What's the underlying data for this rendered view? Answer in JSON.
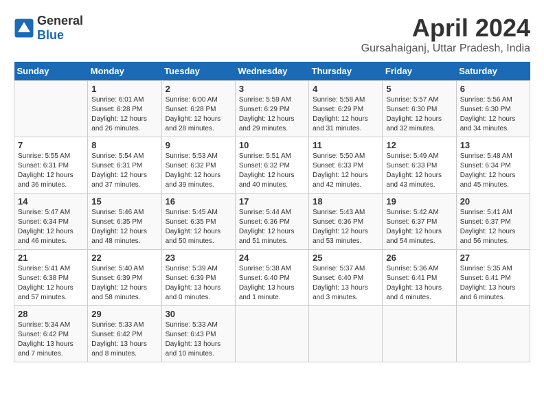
{
  "logo": {
    "text_general": "General",
    "text_blue": "Blue"
  },
  "header": {
    "month": "April 2024",
    "location": "Gursahaiganj, Uttar Pradesh, India"
  },
  "weekdays": [
    "Sunday",
    "Monday",
    "Tuesday",
    "Wednesday",
    "Thursday",
    "Friday",
    "Saturday"
  ],
  "rows": [
    [
      {
        "day": "",
        "sunrise": "",
        "sunset": "",
        "daylight": ""
      },
      {
        "day": "1",
        "sunrise": "Sunrise: 6:01 AM",
        "sunset": "Sunset: 6:28 PM",
        "daylight": "Daylight: 12 hours and 26 minutes."
      },
      {
        "day": "2",
        "sunrise": "Sunrise: 6:00 AM",
        "sunset": "Sunset: 6:28 PM",
        "daylight": "Daylight: 12 hours and 28 minutes."
      },
      {
        "day": "3",
        "sunrise": "Sunrise: 5:59 AM",
        "sunset": "Sunset: 6:29 PM",
        "daylight": "Daylight: 12 hours and 29 minutes."
      },
      {
        "day": "4",
        "sunrise": "Sunrise: 5:58 AM",
        "sunset": "Sunset: 6:29 PM",
        "daylight": "Daylight: 12 hours and 31 minutes."
      },
      {
        "day": "5",
        "sunrise": "Sunrise: 5:57 AM",
        "sunset": "Sunset: 6:30 PM",
        "daylight": "Daylight: 12 hours and 32 minutes."
      },
      {
        "day": "6",
        "sunrise": "Sunrise: 5:56 AM",
        "sunset": "Sunset: 6:30 PM",
        "daylight": "Daylight: 12 hours and 34 minutes."
      }
    ],
    [
      {
        "day": "7",
        "sunrise": "Sunrise: 5:55 AM",
        "sunset": "Sunset: 6:31 PM",
        "daylight": "Daylight: 12 hours and 36 minutes."
      },
      {
        "day": "8",
        "sunrise": "Sunrise: 5:54 AM",
        "sunset": "Sunset: 6:31 PM",
        "daylight": "Daylight: 12 hours and 37 minutes."
      },
      {
        "day": "9",
        "sunrise": "Sunrise: 5:53 AM",
        "sunset": "Sunset: 6:32 PM",
        "daylight": "Daylight: 12 hours and 39 minutes."
      },
      {
        "day": "10",
        "sunrise": "Sunrise: 5:51 AM",
        "sunset": "Sunset: 6:32 PM",
        "daylight": "Daylight: 12 hours and 40 minutes."
      },
      {
        "day": "11",
        "sunrise": "Sunrise: 5:50 AM",
        "sunset": "Sunset: 6:33 PM",
        "daylight": "Daylight: 12 hours and 42 minutes."
      },
      {
        "day": "12",
        "sunrise": "Sunrise: 5:49 AM",
        "sunset": "Sunset: 6:33 PM",
        "daylight": "Daylight: 12 hours and 43 minutes."
      },
      {
        "day": "13",
        "sunrise": "Sunrise: 5:48 AM",
        "sunset": "Sunset: 6:34 PM",
        "daylight": "Daylight: 12 hours and 45 minutes."
      }
    ],
    [
      {
        "day": "14",
        "sunrise": "Sunrise: 5:47 AM",
        "sunset": "Sunset: 6:34 PM",
        "daylight": "Daylight: 12 hours and 46 minutes."
      },
      {
        "day": "15",
        "sunrise": "Sunrise: 5:46 AM",
        "sunset": "Sunset: 6:35 PM",
        "daylight": "Daylight: 12 hours and 48 minutes."
      },
      {
        "day": "16",
        "sunrise": "Sunrise: 5:45 AM",
        "sunset": "Sunset: 6:35 PM",
        "daylight": "Daylight: 12 hours and 50 minutes."
      },
      {
        "day": "17",
        "sunrise": "Sunrise: 5:44 AM",
        "sunset": "Sunset: 6:36 PM",
        "daylight": "Daylight: 12 hours and 51 minutes."
      },
      {
        "day": "18",
        "sunrise": "Sunrise: 5:43 AM",
        "sunset": "Sunset: 6:36 PM",
        "daylight": "Daylight: 12 hours and 53 minutes."
      },
      {
        "day": "19",
        "sunrise": "Sunrise: 5:42 AM",
        "sunset": "Sunset: 6:37 PM",
        "daylight": "Daylight: 12 hours and 54 minutes."
      },
      {
        "day": "20",
        "sunrise": "Sunrise: 5:41 AM",
        "sunset": "Sunset: 6:37 PM",
        "daylight": "Daylight: 12 hours and 56 minutes."
      }
    ],
    [
      {
        "day": "21",
        "sunrise": "Sunrise: 5:41 AM",
        "sunset": "Sunset: 6:38 PM",
        "daylight": "Daylight: 12 hours and 57 minutes."
      },
      {
        "day": "22",
        "sunrise": "Sunrise: 5:40 AM",
        "sunset": "Sunset: 6:39 PM",
        "daylight": "Daylight: 12 hours and 58 minutes."
      },
      {
        "day": "23",
        "sunrise": "Sunrise: 5:39 AM",
        "sunset": "Sunset: 6:39 PM",
        "daylight": "Daylight: 13 hours and 0 minutes."
      },
      {
        "day": "24",
        "sunrise": "Sunrise: 5:38 AM",
        "sunset": "Sunset: 6:40 PM",
        "daylight": "Daylight: 13 hours and 1 minute."
      },
      {
        "day": "25",
        "sunrise": "Sunrise: 5:37 AM",
        "sunset": "Sunset: 6:40 PM",
        "daylight": "Daylight: 13 hours and 3 minutes."
      },
      {
        "day": "26",
        "sunrise": "Sunrise: 5:36 AM",
        "sunset": "Sunset: 6:41 PM",
        "daylight": "Daylight: 13 hours and 4 minutes."
      },
      {
        "day": "27",
        "sunrise": "Sunrise: 5:35 AM",
        "sunset": "Sunset: 6:41 PM",
        "daylight": "Daylight: 13 hours and 6 minutes."
      }
    ],
    [
      {
        "day": "28",
        "sunrise": "Sunrise: 5:34 AM",
        "sunset": "Sunset: 6:42 PM",
        "daylight": "Daylight: 13 hours and 7 minutes."
      },
      {
        "day": "29",
        "sunrise": "Sunrise: 5:33 AM",
        "sunset": "Sunset: 6:42 PM",
        "daylight": "Daylight: 13 hours and 8 minutes."
      },
      {
        "day": "30",
        "sunrise": "Sunrise: 5:33 AM",
        "sunset": "Sunset: 6:43 PM",
        "daylight": "Daylight: 13 hours and 10 minutes."
      },
      {
        "day": "",
        "sunrise": "",
        "sunset": "",
        "daylight": ""
      },
      {
        "day": "",
        "sunrise": "",
        "sunset": "",
        "daylight": ""
      },
      {
        "day": "",
        "sunrise": "",
        "sunset": "",
        "daylight": ""
      },
      {
        "day": "",
        "sunrise": "",
        "sunset": "",
        "daylight": ""
      }
    ]
  ]
}
